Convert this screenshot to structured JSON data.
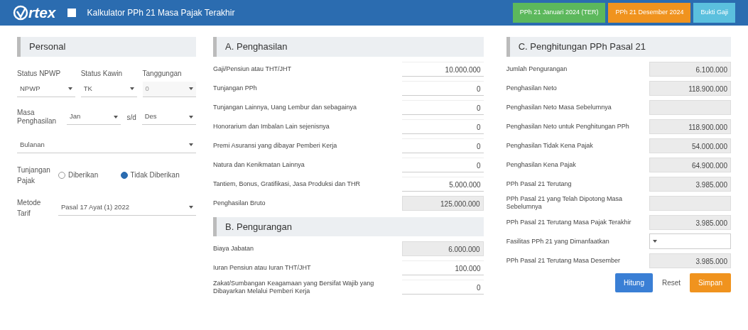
{
  "header": {
    "logo": "rtex",
    "title": "Kalkulator PPh 21 Masa Pajak Terakhir",
    "buttons": [
      {
        "label": "PPh 21 Januari 2024 (TER)",
        "color": "#5cb85c"
      },
      {
        "label": "PPh 21 Desember 2024",
        "color": "#f0931e"
      },
      {
        "label": "Bukti Gaji",
        "color": "#5bc0de"
      }
    ]
  },
  "personal": {
    "title": "Personal",
    "selects": [
      {
        "label": "Status NPWP",
        "value": "NPWP",
        "disabled": false
      },
      {
        "label": "Status Kawin",
        "value": "TK",
        "disabled": false
      },
      {
        "label": "Tanggungan",
        "value": "0",
        "disabled": true
      }
    ],
    "period": {
      "label": "Masa Penghasilan",
      "from": "Jan",
      "sep": "s/d",
      "to": "Des"
    },
    "type_select": {
      "value": "Bulanan"
    },
    "allowance": {
      "label": "Tunjangan Pajak",
      "options": [
        {
          "label": "Diberikan",
          "selected": false
        },
        {
          "label": "Tidak Diberikan",
          "selected": true
        }
      ]
    },
    "method": {
      "label": "Metode Tarif",
      "value": "Pasal 17 Ayat (1) 2022"
    }
  },
  "income": {
    "title": "A. Penghasilan",
    "rows": [
      {
        "label": "Gaji/Pensiun atau THT/JHT",
        "value": "10.000.000",
        "readonly": false
      },
      {
        "label": "Tunjangan PPh",
        "value": "0",
        "readonly": false
      },
      {
        "label": "Tunjangan Lainnya, Uang Lembur dan sebagainya",
        "value": "0",
        "readonly": false
      },
      {
        "label": "Honorarium dan Imbalan Lain sejenisnya",
        "value": "0",
        "readonly": false
      },
      {
        "label": "Premi Asuransi yang dibayar Pemberi Kerja",
        "value": "0",
        "readonly": false
      },
      {
        "label": "Natura dan Kenikmatan Lainnya",
        "value": "0",
        "readonly": false
      },
      {
        "label": "Tantiem, Bonus, Gratifikasi, Jasa Produksi dan THR",
        "value": "5.000.000",
        "readonly": false
      },
      {
        "label": "Penghasilan Bruto",
        "value": "125.000.000",
        "readonly": true
      }
    ]
  },
  "deductions": {
    "title": "B. Pengurangan",
    "rows": [
      {
        "label": "Biaya Jabatan",
        "value": "6.000.000",
        "readonly": true
      },
      {
        "label": "Iuran Pensiun atau Iuran THT/JHT",
        "value": "100.000",
        "readonly": false
      },
      {
        "label": "Zakat/Sumbangan Keagamaan yang Bersifat Wajib yang Dibayarkan Melalui Pemberi Kerja",
        "value": "0",
        "readonly": false
      }
    ]
  },
  "calc": {
    "title": "C. Penghitungan PPh Pasal 21",
    "rows": [
      {
        "label": "Jumlah Pengurangan",
        "value": "6.100.000",
        "kind": "readonly"
      },
      {
        "label": "Penghasilan Neto",
        "value": "118.900.000",
        "kind": "readonly"
      },
      {
        "label": "Penghasilan Neto Masa Sebelumnya",
        "value": "",
        "kind": "readonly"
      },
      {
        "label": "Penghasilan Neto untuk Penghitungan PPh",
        "value": "118.900.000",
        "kind": "readonly"
      },
      {
        "label": "Penghasilan Tidak Kena Pajak",
        "value": "54.000.000",
        "kind": "readonly"
      },
      {
        "label": "Penghasilan Kena Pajak",
        "value": "64.900.000",
        "kind": "readonly"
      },
      {
        "label": "PPh Pasal 21 Terutang",
        "value": "3.985.000",
        "kind": "readonly"
      },
      {
        "label": "PPh Pasal 21 yang Telah Dipotong Masa Sebelumnya",
        "value": "",
        "kind": "readonly"
      },
      {
        "label": "PPh Pasal 21 Terutang Masa Pajak Terakhir",
        "value": "3.985.000",
        "kind": "readonly"
      },
      {
        "label": "Fasilitas PPh 21 yang Dimanfaatkan",
        "value": "",
        "kind": "select"
      },
      {
        "label": "PPh Pasal 21 Terutang Masa Desember",
        "value": "3.985.000",
        "kind": "readonly"
      }
    ],
    "buttons": [
      {
        "label": "Hitung",
        "kind": "primary"
      },
      {
        "label": "Reset",
        "kind": "link"
      },
      {
        "label": "Simpan",
        "kind": "warning"
      }
    ]
  }
}
